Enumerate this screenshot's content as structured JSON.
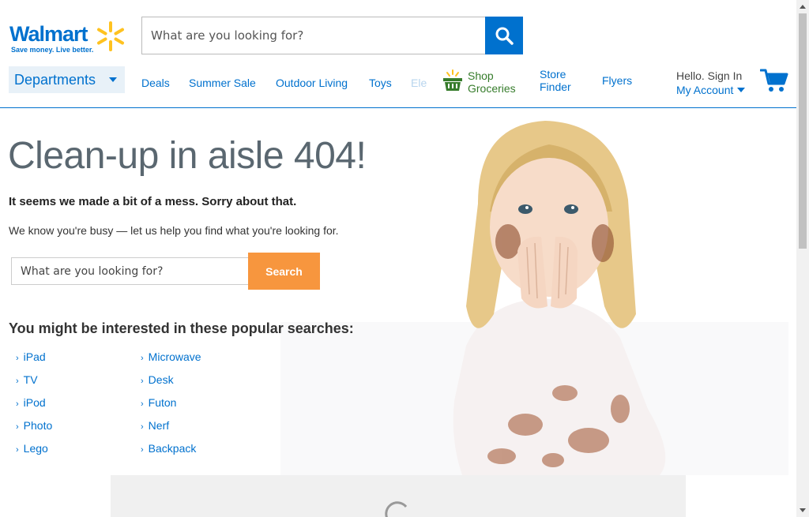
{
  "header": {
    "logo_text": "Walmart",
    "logo_tagline": "Save money. Live better.",
    "search_placeholder": "What are you looking for?",
    "departments_label": "Departments",
    "nav": [
      {
        "label": "Deals"
      },
      {
        "label": "Summer Sale"
      },
      {
        "label": "Outdoor Living"
      },
      {
        "label": "Toys"
      },
      {
        "label": "Ele"
      }
    ],
    "groceries_line1": "Shop",
    "groceries_line2": "Groceries",
    "store_finder_line1": "Store",
    "store_finder_line2": "Finder",
    "flyers": "Flyers",
    "hello": "Hello. Sign In",
    "my_account": "My Account",
    "colors": {
      "brand_blue": "#0071ce",
      "spark_yellow": "#ffc220",
      "grocery_green": "#367c2b",
      "search_orange": "#f7963e"
    }
  },
  "main": {
    "title": "Clean-up in aisle 404!",
    "subtitle": "It seems we made a bit of a mess. Sorry about that.",
    "help_text": "We know you're busy — let us help you find what you're looking for.",
    "search_placeholder": "What are you looking for?",
    "search_button": "Search",
    "popular_title": "You might be interested in these popular searches:",
    "popular_col1": [
      "iPad",
      "TV",
      "iPod",
      "Photo",
      "Lego"
    ],
    "popular_col2": [
      "Microwave",
      "Desk",
      "Futon",
      "Nerf",
      "Backpack"
    ]
  }
}
